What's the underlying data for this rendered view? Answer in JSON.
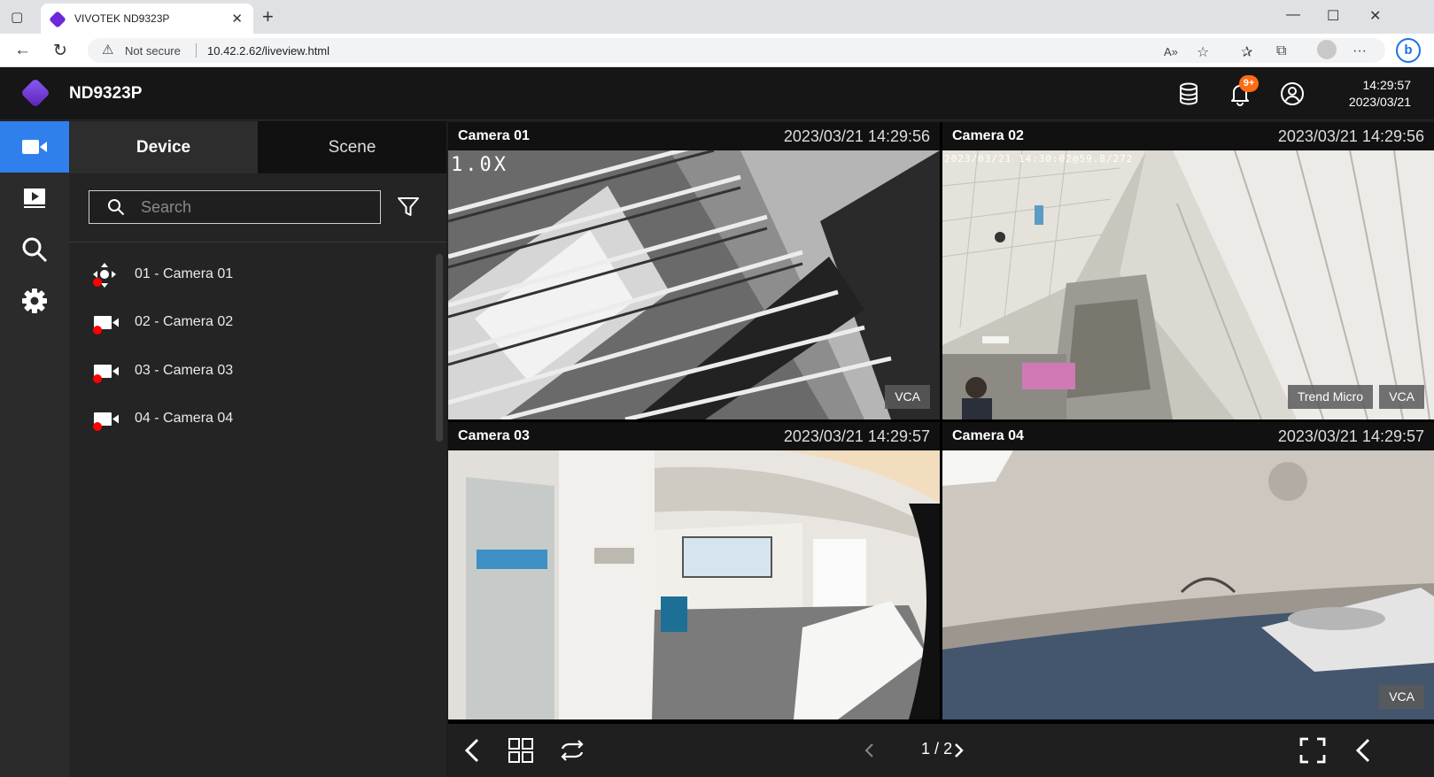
{
  "browser": {
    "tab_title": "VIVOTEK ND9323P",
    "security_label": "Not secure",
    "url": "10.42.2.62/liveview.html"
  },
  "app": {
    "title": "ND9323P",
    "notification_count": "9+",
    "time": "14:29:57",
    "date": "2023/03/21"
  },
  "panel": {
    "tabs": [
      {
        "label": "Device",
        "active": true
      },
      {
        "label": "Scene",
        "active": false
      }
    ],
    "search_placeholder": "Search",
    "cameras": [
      {
        "label": "01 - Camera 01",
        "icon": "ptz-camera-icon"
      },
      {
        "label": "02 - Camera 02",
        "icon": "camera-icon"
      },
      {
        "label": "03 - Camera 03",
        "icon": "camera-icon"
      },
      {
        "label": "04 - Camera 04",
        "icon": "camera-icon"
      }
    ],
    "status_color": "#ff0000"
  },
  "tiles": [
    {
      "name": "Camera 01",
      "timestamp": "2023/03/21 14:29:56",
      "osd": "1.0X",
      "tags": [
        "VCA"
      ]
    },
    {
      "name": "Camera 02",
      "timestamp": "2023/03/21 14:29:56",
      "osd": "2023/03/21 14:30:02@59.8/272",
      "tags": [
        "Trend Micro",
        "VCA"
      ]
    },
    {
      "name": "Camera 03",
      "timestamp": "2023/03/21 14:29:57",
      "osd": "",
      "tags": []
    },
    {
      "name": "Camera 04",
      "timestamp": "2023/03/21 14:29:57",
      "osd": "",
      "tags": [
        "VCA"
      ]
    }
  ],
  "pager": {
    "current": "1",
    "separator": "/",
    "total": "2"
  },
  "colors": {
    "accent": "#2f80ed",
    "badge": "#ff6a13",
    "brand": "#6d28d9"
  }
}
